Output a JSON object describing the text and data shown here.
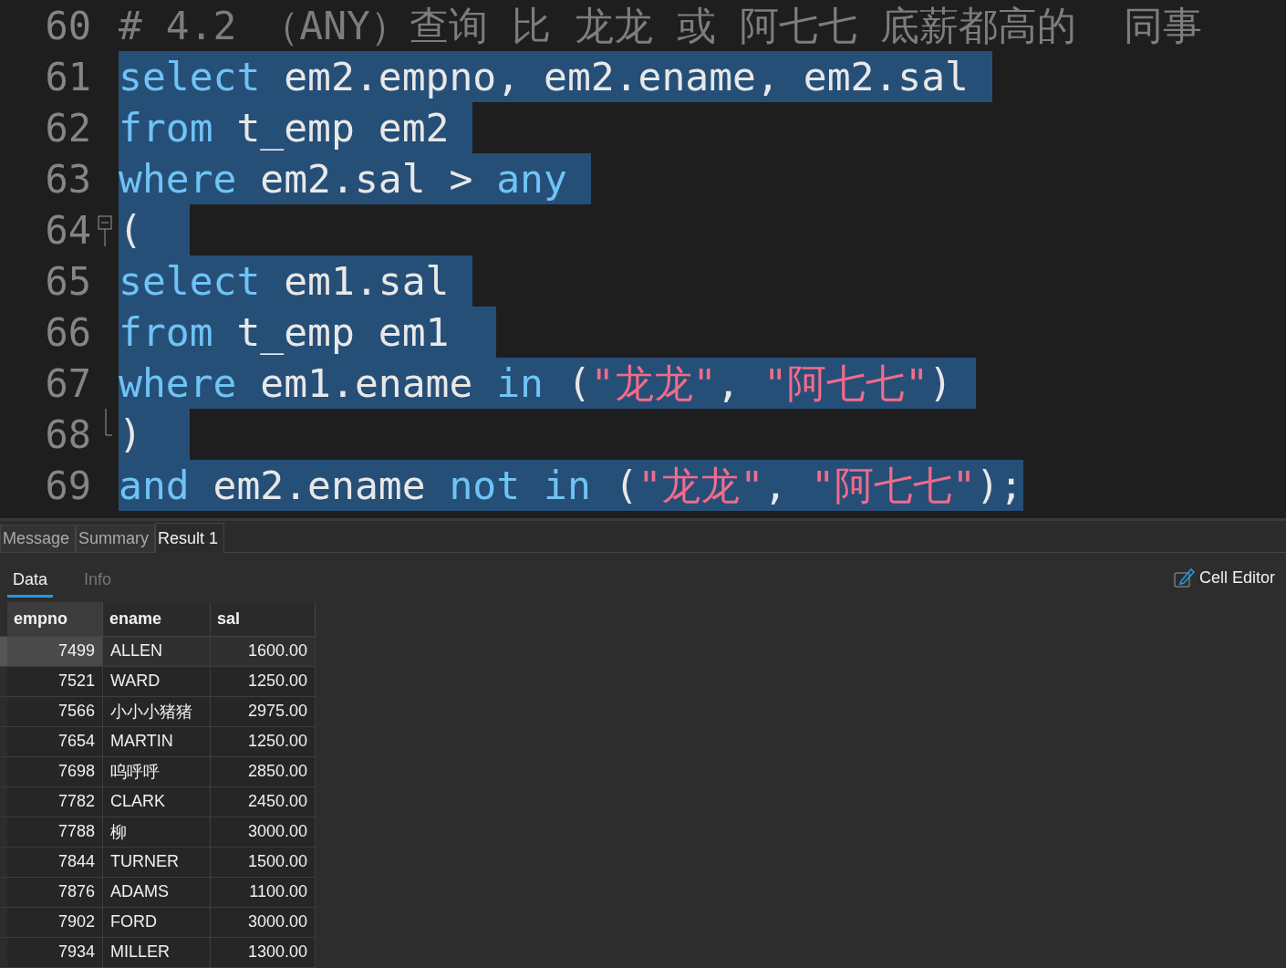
{
  "editor": {
    "lines": [
      {
        "number": "60",
        "selected": false,
        "tokens": [
          {
            "text": "# 4.2 （ANY）查询 比 龙龙 或 阿七七 底薪都高的  同事",
            "kind": "comment"
          }
        ]
      },
      {
        "number": "61",
        "selected": true,
        "tokens": [
          {
            "text": "select",
            "kind": "keyword"
          },
          {
            "text": " em2.empno, em2.ename, em2.sal ",
            "kind": "plain"
          }
        ]
      },
      {
        "number": "62",
        "selected": true,
        "tokens": [
          {
            "text": "from",
            "kind": "keyword"
          },
          {
            "text": " t_emp em2 ",
            "kind": "plain"
          }
        ]
      },
      {
        "number": "63",
        "selected": true,
        "tokens": [
          {
            "text": "where",
            "kind": "keyword"
          },
          {
            "text": " em2.sal > ",
            "kind": "plain"
          },
          {
            "text": "any ",
            "kind": "keyword"
          }
        ]
      },
      {
        "number": "64",
        "selected": true,
        "fold_open": true,
        "tokens": [
          {
            "text": "(  ",
            "kind": "plain"
          }
        ]
      },
      {
        "number": "65",
        "selected": true,
        "tokens": [
          {
            "text": "select",
            "kind": "keyword"
          },
          {
            "text": " em1.sal ",
            "kind": "plain"
          }
        ]
      },
      {
        "number": "66",
        "selected": true,
        "tokens": [
          {
            "text": "from",
            "kind": "keyword"
          },
          {
            "text": " t_emp em1  ",
            "kind": "plain"
          }
        ]
      },
      {
        "number": "67",
        "selected": true,
        "tokens": [
          {
            "text": "where",
            "kind": "keyword"
          },
          {
            "text": " em1.ename ",
            "kind": "plain"
          },
          {
            "text": "in",
            "kind": "keyword"
          },
          {
            "text": " (",
            "kind": "plain"
          },
          {
            "text": "\"龙龙\"",
            "kind": "string"
          },
          {
            "text": ", ",
            "kind": "plain"
          },
          {
            "text": "\"阿七七\"",
            "kind": "string"
          },
          {
            "text": ") ",
            "kind": "plain"
          }
        ]
      },
      {
        "number": "68",
        "selected": true,
        "fold_close": true,
        "tokens": [
          {
            "text": ")  ",
            "kind": "plain"
          }
        ]
      },
      {
        "number": "69",
        "selected": true,
        "tokens": [
          {
            "text": "and",
            "kind": "keyword"
          },
          {
            "text": " em2.ename ",
            "kind": "plain"
          },
          {
            "text": "not in",
            "kind": "keyword"
          },
          {
            "text": " (",
            "kind": "plain"
          },
          {
            "text": "\"龙龙\"",
            "kind": "string"
          },
          {
            "text": ", ",
            "kind": "plain"
          },
          {
            "text": "\"阿七七\"",
            "kind": "string"
          },
          {
            "text": ");",
            "kind": "plain"
          }
        ]
      }
    ]
  },
  "result_tabs": [
    {
      "label": "Message",
      "selected": false
    },
    {
      "label": "Summary",
      "selected": false
    },
    {
      "label": "Result 1",
      "selected": true
    }
  ],
  "sub_tabs": [
    {
      "label": "Data",
      "selected": true
    },
    {
      "label": "Info",
      "selected": false
    }
  ],
  "cell_editor": {
    "label": "Cell Editor"
  },
  "table": {
    "columns": [
      "empno",
      "ename",
      "sal"
    ],
    "rows": [
      {
        "cells": [
          "7499",
          "ALLEN",
          "1600.00"
        ],
        "selected": true
      },
      {
        "cells": [
          "7521",
          "WARD",
          "1250.00"
        ],
        "selected": false
      },
      {
        "cells": [
          "7566",
          "小小小猪猪",
          "2975.00"
        ],
        "selected": false
      },
      {
        "cells": [
          "7654",
          "MARTIN",
          "1250.00"
        ],
        "selected": false
      },
      {
        "cells": [
          "7698",
          "呜呼呼",
          "2850.00"
        ],
        "selected": false
      },
      {
        "cells": [
          "7782",
          "CLARK",
          "2450.00"
        ],
        "selected": false
      },
      {
        "cells": [
          "7788",
          "柳",
          "3000.00"
        ],
        "selected": false
      },
      {
        "cells": [
          "7844",
          "TURNER",
          "1500.00"
        ],
        "selected": false
      },
      {
        "cells": [
          "7876",
          "ADAMS",
          "1100.00"
        ],
        "selected": false
      },
      {
        "cells": [
          "7902",
          "FORD",
          "3000.00"
        ],
        "selected": false
      },
      {
        "cells": [
          "7934",
          "MILLER",
          "1300.00"
        ],
        "selected": false
      }
    ]
  }
}
